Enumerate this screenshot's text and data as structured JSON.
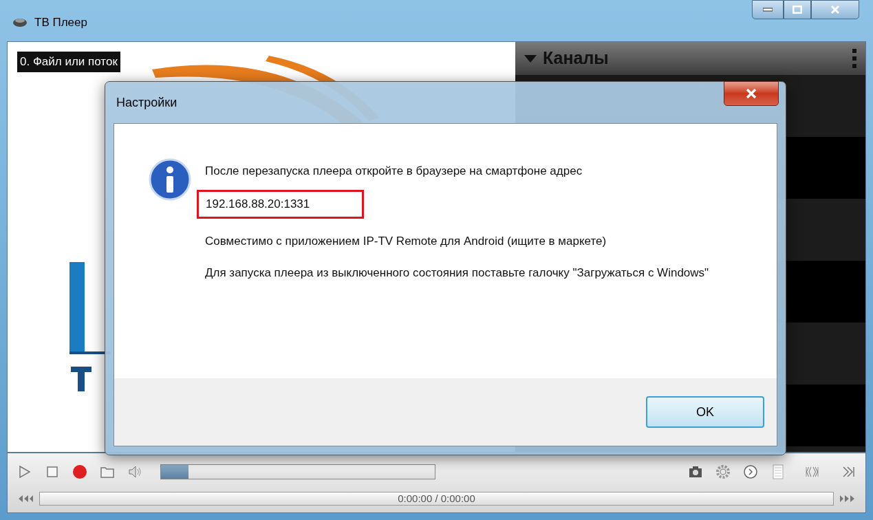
{
  "window": {
    "title": "ТВ Плеер"
  },
  "video": {
    "source_label": "0. Файл или поток"
  },
  "channels_panel": {
    "title": "Каналы",
    "expanded": true
  },
  "dialog": {
    "title": "Настройки",
    "message": "После перезапуска плеера откройте в браузере на смартфоне адрес",
    "address": "192.168.88.20:1331",
    "paragraphs": [
      "Совместимо с приложением IP-TV Remote для Android (ищите в маркете)",
      "Для запуска плеера из выключенного состояния поставьте галочку \"Загружаться с Windows\""
    ],
    "button": "OK"
  },
  "controls": {
    "volume": {
      "level": 0.1
    },
    "time": "0:00:00 / 0:00:00"
  }
}
